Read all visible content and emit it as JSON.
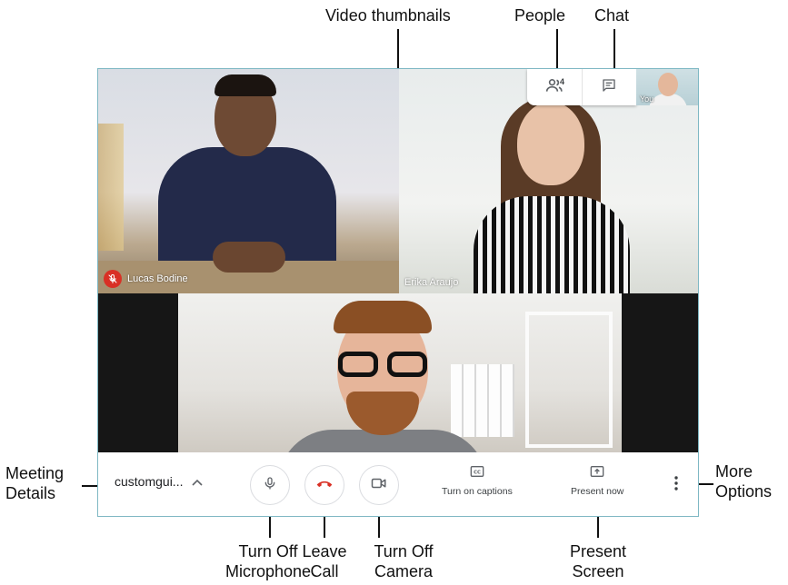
{
  "annotations": {
    "video_thumbnails": "Video thumbnails",
    "people": "People",
    "chat": "Chat",
    "meeting_details_line1": "Meeting",
    "meeting_details_line2": "Details",
    "more_options_line1": "More",
    "more_options_line2": "Options",
    "turn_off_mic_line1": "Turn Off",
    "turn_off_mic_line2": "Microphone",
    "leave_call_line1": "Leave",
    "leave_call_line2": "Call",
    "turn_off_camera_line1": "Turn Off",
    "turn_off_camera_line2": "Camera",
    "present_screen_line1": "Present",
    "present_screen_line2": "Screen"
  },
  "participants": [
    {
      "name": "Lucas Bodine",
      "muted": true
    },
    {
      "name": "Erika Araujo",
      "muted": false
    }
  ],
  "top_controls": {
    "people_icon": "people-icon",
    "people_count": "4",
    "chat_icon": "chat-icon",
    "self_label": "You"
  },
  "bottom_bar": {
    "meeting_code": "customgui...",
    "captions_label": "Turn on captions",
    "present_label": "Present now"
  },
  "colors": {
    "leave_red": "#d93025",
    "icon_gray": "#5f6368",
    "window_border": "#7fb8c4"
  }
}
